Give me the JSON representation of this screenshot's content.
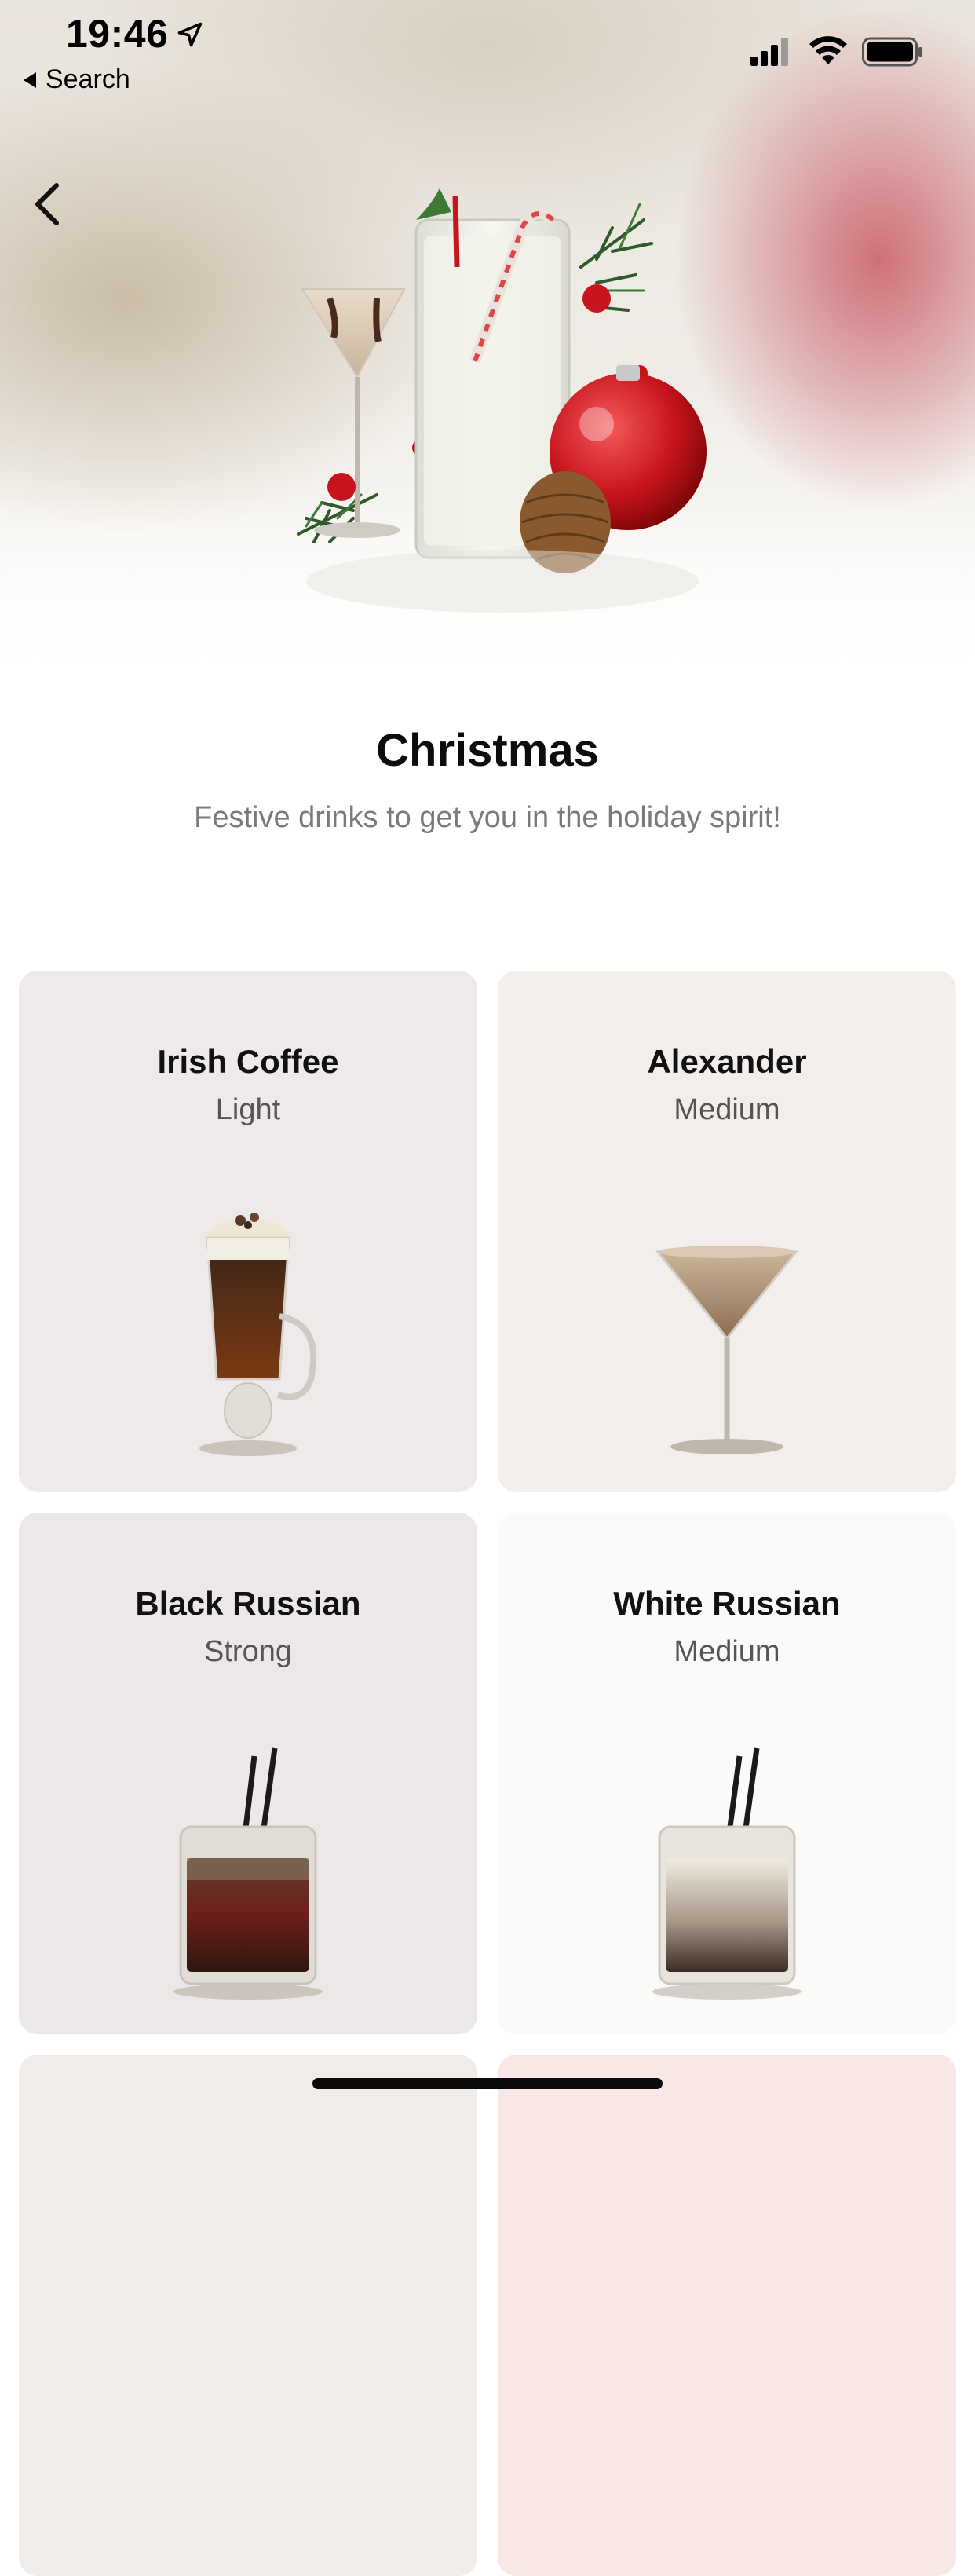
{
  "status_bar": {
    "time": "19:46",
    "back_label": "Search"
  },
  "header": {
    "title": "Christmas",
    "subtitle": "Festive drinks to get you in the holiday spirit!"
  },
  "cards": [
    {
      "name": "Irish Coffee",
      "strength": "Light"
    },
    {
      "name": "Alexander",
      "strength": "Medium"
    },
    {
      "name": "Black Russian",
      "strength": "Strong"
    },
    {
      "name": "White Russian",
      "strength": "Medium"
    }
  ],
  "colors": {
    "accent_red": "#c8242c",
    "card_bg": "#eeebea",
    "subtitle_gray": "#7a7a7a"
  },
  "icons": [
    "location-arrow-icon",
    "signal-icon",
    "wifi-icon",
    "battery-icon",
    "chevron-left-icon"
  ]
}
